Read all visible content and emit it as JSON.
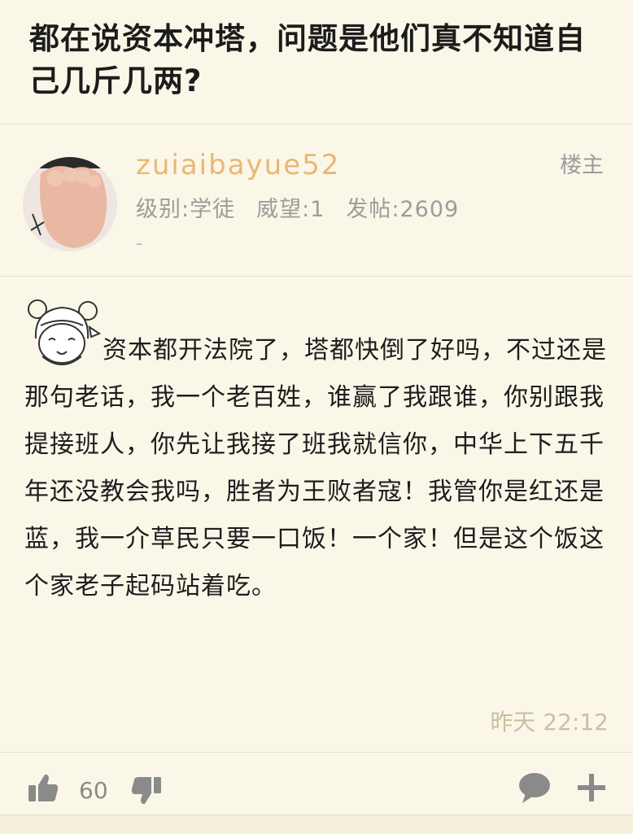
{
  "post": {
    "title": "都在说资本冲塔，问题是他们真不知道自己几斤几两?"
  },
  "author": {
    "username": "zuiaibayue52",
    "level": "级别:学徒",
    "reputation": "威望:1",
    "post_count": "发帖:2609",
    "signature": "-",
    "floor_label": "楼主"
  },
  "content": {
    "text": "资本都开法院了，塔都快倒了好吗，不过还是那句老话，我一个老百姓，谁赢了我跟谁，你别跟我提接班人，你先让我接了班我就信你，中华上下五千年还没教会我吗，胜者为王败者寇！我管你是红还是蓝，我一介草民只要一口饭！一个家！但是这个饭这个家老子起码站着吃。",
    "timestamp": "昨天 22:12"
  },
  "actions": {
    "like_count": "60",
    "icons": [
      "thumbs-up-icon",
      "thumbs-down-icon",
      "comment-icon",
      "plus-icon"
    ]
  },
  "colors": {
    "background": "#fbf7e8",
    "username": "#e8b873",
    "muted": "#9c9c9c",
    "icon": "#8a8a8a"
  }
}
